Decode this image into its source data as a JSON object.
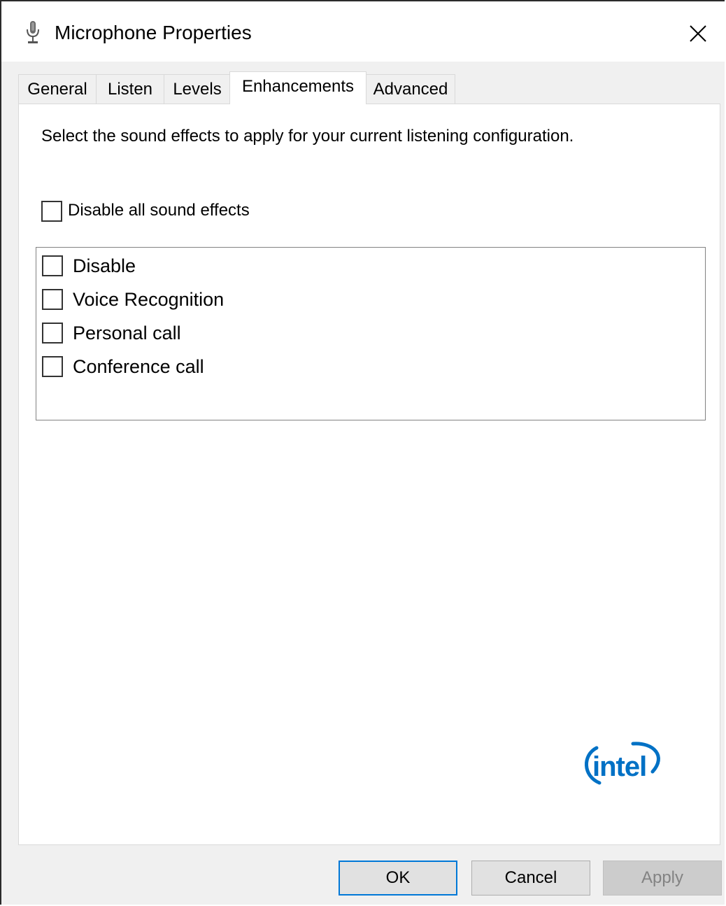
{
  "window": {
    "title": "Microphone Properties",
    "icon": "microphone-icon",
    "close_icon": "close-icon"
  },
  "tabs": [
    {
      "label": "General",
      "active": false
    },
    {
      "label": "Listen",
      "active": false
    },
    {
      "label": "Levels",
      "active": false
    },
    {
      "label": "Enhancements",
      "active": true
    },
    {
      "label": "Advanced",
      "active": false
    }
  ],
  "enhancements": {
    "description": "Select the sound effects to apply for your current listening configuration.",
    "disable_all": {
      "label": "Disable all sound effects",
      "checked": false
    },
    "effects": [
      {
        "label": "Disable",
        "checked": false
      },
      {
        "label": "Voice Recognition",
        "checked": false
      },
      {
        "label": "Personal call",
        "checked": false
      },
      {
        "label": "Conference call",
        "checked": false
      }
    ],
    "vendor_logo": {
      "text": "intel",
      "color": "#0071c5"
    }
  },
  "buttons": {
    "ok": "OK",
    "cancel": "Cancel",
    "apply": "Apply",
    "apply_enabled": false
  },
  "colors": {
    "accent": "#0078d7",
    "dialog_background": "#f0f0f0"
  }
}
